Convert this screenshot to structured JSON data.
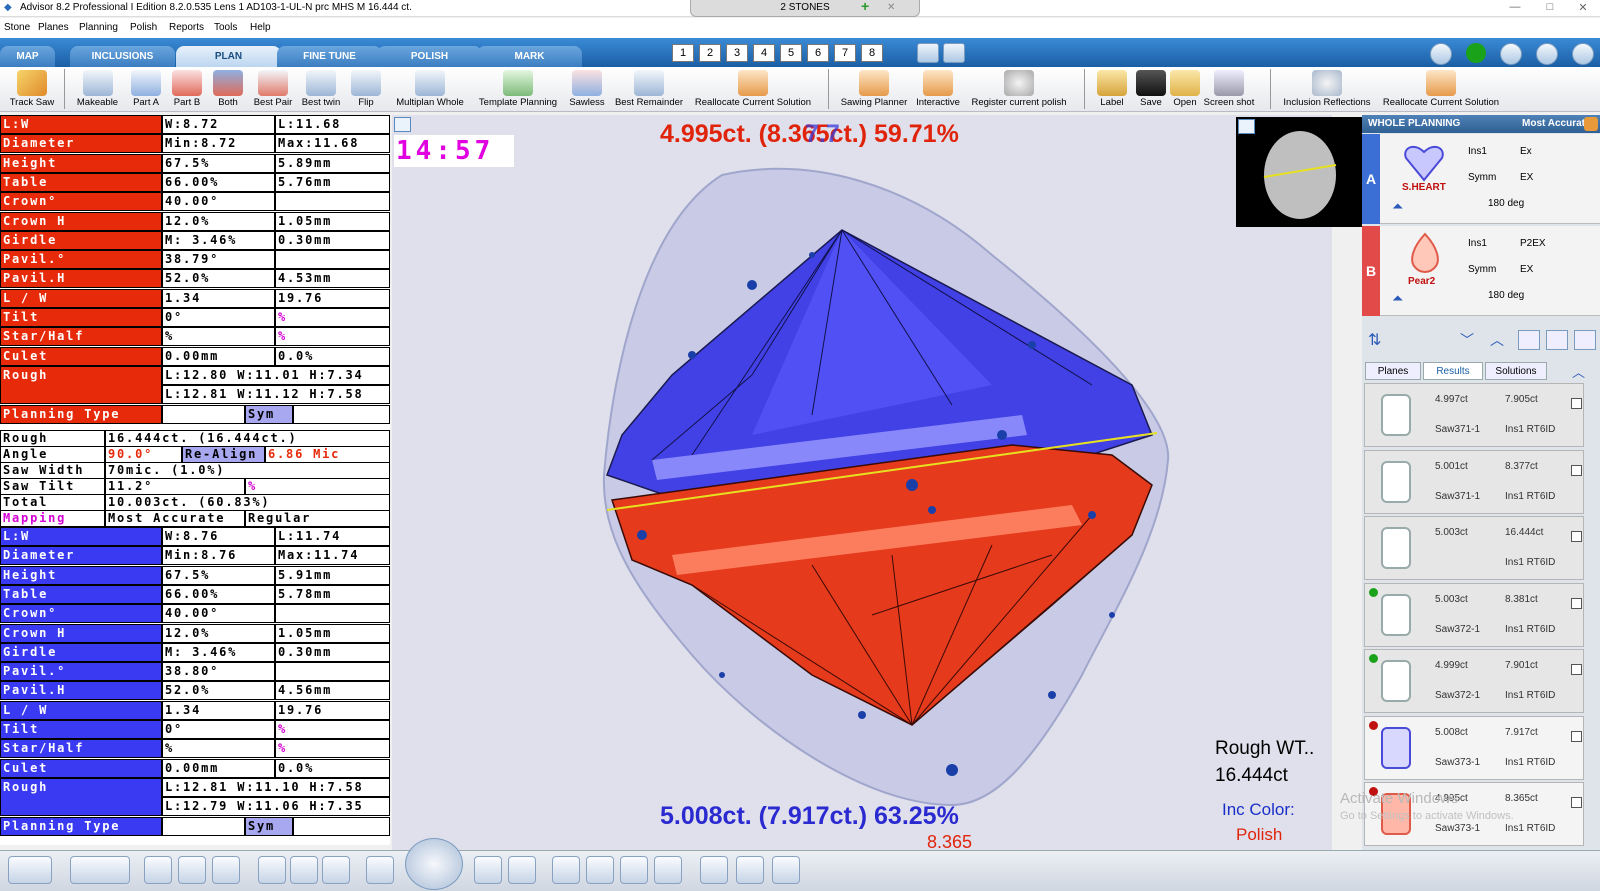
{
  "window": {
    "title": "Advisor 8.2 Professional I Edition  8.2.0.535   Lens 1   AD103-1-UL-N prc MHS M   16.444 ct.",
    "stones_tab": "2 STONES",
    "add": "+",
    "close": "✕",
    "min": "—",
    "max": "□",
    "x": "✕"
  },
  "menu": [
    "Stone",
    "Planes",
    "Planning",
    "Polish",
    "Reports",
    "Tools",
    "Help"
  ],
  "tabs": [
    "MAP",
    "INCLUSIONS",
    "PLAN",
    "FINE TUNE",
    "POLISH",
    "MARK"
  ],
  "stone_numbers": [
    "1",
    "2",
    "3",
    "4",
    "5",
    "6",
    "7",
    "8"
  ],
  "toolbar": [
    "Track Saw",
    "Makeable",
    "Part A",
    "Part B",
    "Both",
    "Best Pair",
    "Best twin",
    "Flip",
    "Multiplan Whole",
    "Template Planning",
    "Sawless",
    "Best Remainder",
    "Reallocate Current Solution",
    "Sawing Planner",
    "Interactive",
    "Register current polish",
    "Label",
    "Save",
    "Open",
    "Screen shot",
    "Inclusion Reflections",
    "Reallocate Current Solution"
  ],
  "partA": [
    [
      "L:W",
      "W:8.72",
      "L:11.68"
    ],
    [
      "Diameter",
      "Min:8.72",
      "Max:11.68"
    ],
    [
      "Height",
      "67.5%",
      "5.89mm"
    ],
    [
      "Table",
      "66.00%",
      "5.76mm"
    ],
    [
      "Crown°",
      "40.00°",
      ""
    ],
    [
      "Crown H",
      "12.0%",
      "1.05mm"
    ],
    [
      "Girdle",
      "M: 3.46%",
      "0.30mm"
    ],
    [
      "Pavil.°",
      "38.79°",
      ""
    ],
    [
      "Pavil.H",
      "52.0%",
      "4.53mm"
    ],
    [
      "L / W",
      "1.34",
      "19.76"
    ],
    [
      "Tilt",
      "0°",
      "%"
    ],
    [
      "Star/Half",
      "%",
      "%"
    ],
    [
      "Culet",
      "0.00mm",
      "0.0%"
    ]
  ],
  "partA_rough": {
    "label": "Rough",
    "line1": "L:12.80 W:11.01 H:7.34",
    "line2": "L:12.81 W:11.12 H:7.58"
  },
  "partA_planning": {
    "label": "Planning Type",
    "value": "Sym"
  },
  "mid": {
    "rough_label": "Rough",
    "rough_val": "16.444ct. (16.444ct.)",
    "angle_label": "Angle",
    "angle_val": "90.0°",
    "realign": "Re-Align",
    "mic": "6.86 Mic",
    "sawwidth_label": "Saw Width",
    "sawwidth_val": "70mic. (1.0%)",
    "sawtilt_label": "Saw Tilt",
    "sawtilt_val": "11.2°",
    "sawtilt_pct": "%",
    "total_label": "Total",
    "total_val": "10.003ct. (60.83%)",
    "mapping_label": "Mapping",
    "mapping_val": "Most Accurate",
    "mapping_val2": "Regular"
  },
  "partB": [
    [
      "L:W",
      "W:8.76",
      "L:11.74"
    ],
    [
      "Diameter",
      "Min:8.76",
      "Max:11.74"
    ],
    [
      "Height",
      "67.5%",
      "5.91mm"
    ],
    [
      "Table",
      "66.00%",
      "5.78mm"
    ],
    [
      "Crown°",
      "40.00°",
      ""
    ],
    [
      "Crown H",
      "12.0%",
      "1.05mm"
    ],
    [
      "Girdle",
      "M: 3.46%",
      "0.30mm"
    ],
    [
      "Pavil.°",
      "38.80°",
      ""
    ],
    [
      "Pavil.H",
      "52.0%",
      "4.56mm"
    ],
    [
      "L / W",
      "1.34",
      "19.76"
    ],
    [
      "Tilt",
      "0°",
      "%"
    ],
    [
      "Star/Half",
      "%",
      "%"
    ],
    [
      "Culet",
      "0.00mm",
      "0.0%"
    ]
  ],
  "partB_rough": {
    "label": "Rough",
    "line1": "L:12.81 W:11.10 H:7.58",
    "line2": "L:12.79 W:11.06 H:7.35"
  },
  "partB_planning": {
    "label": "Planning Type",
    "value": "Sym"
  },
  "timer": "14:57",
  "viewport": {
    "top": "4.995ct. (8.365ct.) 59.71%",
    "top_overlay": "7.7",
    "bottom": "5.008ct. (7.917ct.) 63.25%",
    "bottom_weight": "8.365",
    "rough_label": "Rough WT..",
    "rough_wt": "16.444ct",
    "inc_color": "Inc Color:",
    "polish": "Polish"
  },
  "right": {
    "header": "WHOLE PLANNING",
    "mode": "Most Accurate",
    "A": {
      "letter": "A",
      "shape": "S.HEART",
      "c1": "Ins1",
      "v1": "Ex",
      "c2": "Symm",
      "v2": "EX",
      "deg": "180 deg",
      "color": "#3b6fd6"
    },
    "B": {
      "letter": "B",
      "shape": "Pear2",
      "c1": "Ins1",
      "v1": "P2EX",
      "c2": "Symm",
      "v2": "EX",
      "deg": "180 deg",
      "color": "#e24a4a"
    },
    "subtabs": [
      "Planes",
      "Results",
      "Solutions"
    ],
    "results": [
      {
        "ct": "4.997ct",
        "total": "7.905ct",
        "saw": "Saw371-1",
        "ins": "Ins1 RT6ID",
        "dot": ""
      },
      {
        "ct": "5.001ct",
        "total": "8.377ct",
        "saw": "Saw371-1",
        "ins": "Ins1 RT6ID",
        "dot": ""
      },
      {
        "ct": "5.003ct",
        "total": "16.444ct",
        "saw": "",
        "ins": "Ins1 RT6ID",
        "dot": ""
      },
      {
        "ct": "5.003ct",
        "total": "8.381ct",
        "saw": "Saw372-1",
        "ins": "Ins1 RT6ID",
        "dot": "green"
      },
      {
        "ct": "4.999ct",
        "total": "7.901ct",
        "saw": "Saw372-1",
        "ins": "Ins1 RT6ID",
        "dot": "green"
      },
      {
        "ct": "5.008ct",
        "total": "7.917ct",
        "saw": "Saw373-1",
        "ins": "Ins1 RT6ID",
        "dot": "red"
      },
      {
        "ct": "4.995ct",
        "total": "8.365ct",
        "saw": "Saw373-1",
        "ins": "Ins1 RT6ID",
        "dot": "red"
      }
    ]
  },
  "watermark": {
    "line1": "Activate Windows",
    "line2": "Go to Settings to activate Windows."
  }
}
